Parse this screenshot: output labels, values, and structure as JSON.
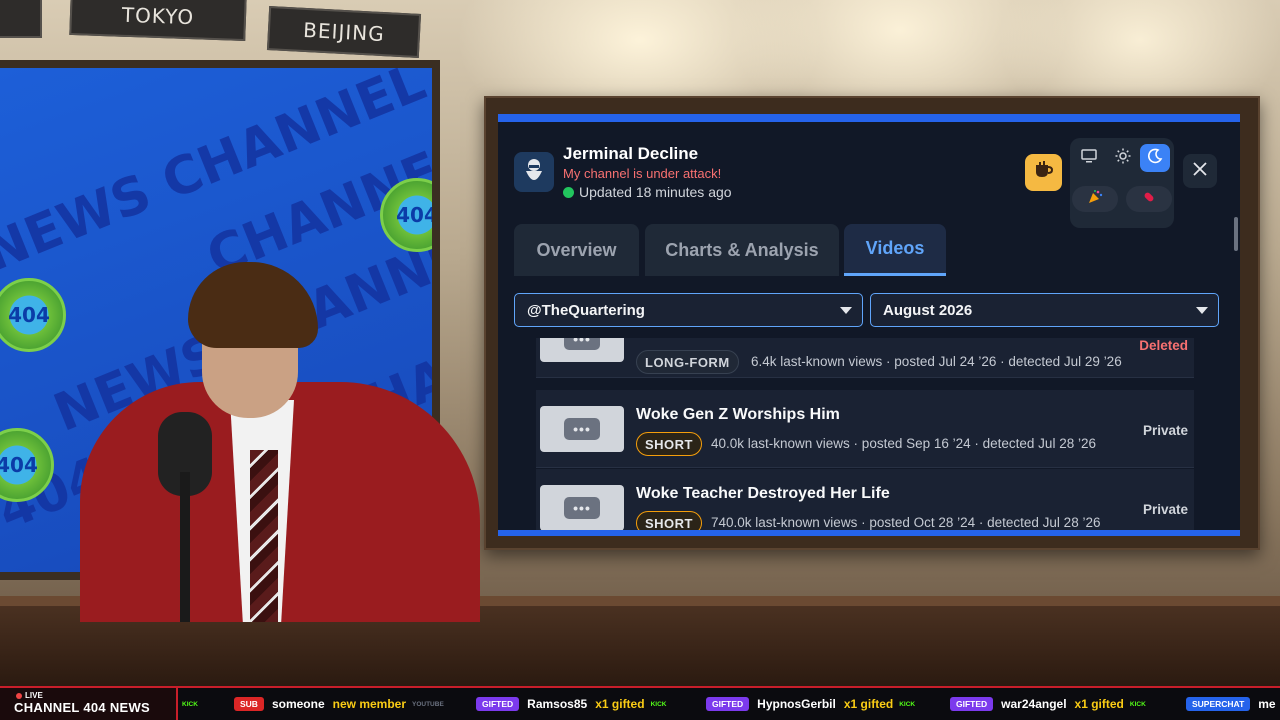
{
  "studio": {
    "signs": [
      "",
      "TOKYO",
      "BEIJING"
    ],
    "screen_text": [
      "NEWS CHANNEL",
      "CHANNEL",
      "NEWS CHANNEL",
      "404 NEWS",
      "CHA",
      "404 NEWS"
    ],
    "badge_text": "404"
  },
  "app": {
    "title": "Jerminal Decline",
    "subtitle": "My channel is under attack!",
    "updated": "Updated 18 minutes ago",
    "colors": {
      "accent": "#60a5fa",
      "border": "#2563eb",
      "alert": "#f87171",
      "online": "#22c55e",
      "coffee": "#f5b942"
    },
    "toolbar": {
      "coffee_icon": "coffee-icon",
      "theme_icons": [
        "monitor-icon",
        "sun-icon",
        "moon-icon"
      ],
      "theme_active": "moon-icon",
      "extra_icons": [
        "party-popper-icon",
        "pill-icon"
      ],
      "x_label": "X"
    },
    "tabs": [
      {
        "label": "Overview",
        "active": false
      },
      {
        "label": "Charts & Analysis",
        "active": false
      },
      {
        "label": "Videos",
        "active": true
      }
    ],
    "filters": {
      "channel": "@TheQuartering",
      "month": "August 2026"
    },
    "videos": [
      {
        "title": "",
        "thumb": "•••",
        "tag": "LONG-FORM",
        "meta": "6.4k last-known views · posted Jul 24 ’26 · detected Jul 29 ’26",
        "status": "Deleted"
      },
      {
        "title": "Woke Gen Z Worships Him",
        "thumb": "•••",
        "tag": "SHORT",
        "meta": "40.0k last-known views · posted Sep 16 ’24 · detected Jul 28 ’26",
        "status": "Private"
      },
      {
        "title": "Woke Teacher Destroyed Her Life",
        "thumb": "•••",
        "tag": "SHORT",
        "meta": "740.0k last-known views · posted Oct 28 ’24 · detected Jul 28 ’26",
        "status": "Private"
      }
    ]
  },
  "ticker": {
    "live_label": "LIVE",
    "channel_name": "CHANNEL 404 NEWS",
    "items": [
      {
        "tag": "",
        "name": "",
        "action": "",
        "source": "KICK",
        "tag_color": "#000000",
        "source_color": "#53fc18"
      },
      {
        "tag": "SUB",
        "name": "someone",
        "action": "new member",
        "source": "YOUTUBE",
        "tag_color": "#dc2626",
        "source_color": "#6b7280"
      },
      {
        "tag": "GIFTED",
        "name": "Ramsos85",
        "action": "x1 gifted",
        "source": "KICK",
        "tag_color": "#7c3aed",
        "source_color": "#53fc18"
      },
      {
        "tag": "GIFTED",
        "name": "HypnosGerbil",
        "action": "x1 gifted",
        "source": "KICK",
        "tag_color": "#7c3aed",
        "source_color": "#53fc18"
      },
      {
        "tag": "GIFTED",
        "name": "war24angel",
        "action": "x1 gifted",
        "source": "KICK",
        "tag_color": "#7c3aed",
        "source_color": "#53fc18"
      },
      {
        "tag": "SUPERCHAT",
        "name": "me",
        "action": "",
        "source": "",
        "tag_color": "#2563eb",
        "source_color": "#6b7280"
      }
    ]
  }
}
